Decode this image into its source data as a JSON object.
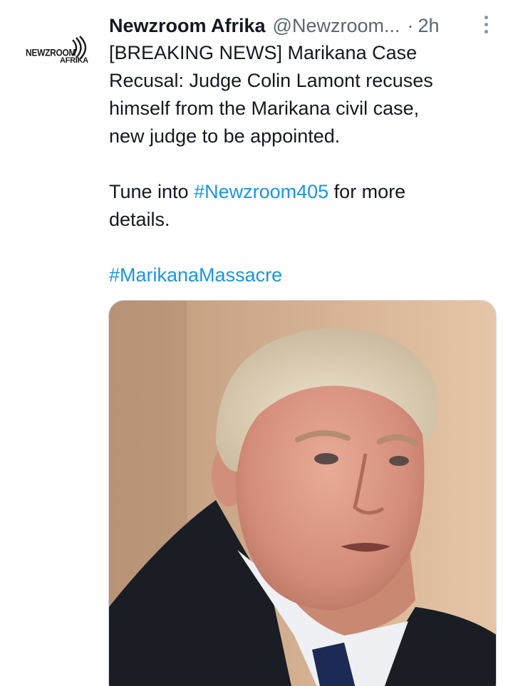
{
  "account": {
    "display_name": "Newzroom Afrika",
    "handle": "@Newzroom...",
    "separator": "·",
    "time_ago": "2h",
    "avatar_text_line1": "NEWZROOM",
    "avatar_text_line2": "AFRIKA"
  },
  "tweet": {
    "line1_label": "[BREAKING NEWS] Marikana Case",
    "line2": "Recusal: Judge Colin Lamont recuses",
    "line3": "himself from the Marikana civil case,",
    "line4": "new judge to be appointed.",
    "para2_prefix": "Tune into ",
    "para2_hashtag": "#Newzroom405",
    "para2_suffix": " for more",
    "para2_line2": "details.",
    "hashtag_final": "#MarikanaMassacre"
  },
  "media": {
    "kind": "photo",
    "subject": "portrait-photo"
  },
  "colors": {
    "hashtag": "#1b95e0",
    "secondary_text": "#5b6670",
    "primary_text": "#141823"
  },
  "icons": {
    "more": "vertical-ellipsis-icon",
    "avatar": "newzroom-afrika-logo"
  }
}
